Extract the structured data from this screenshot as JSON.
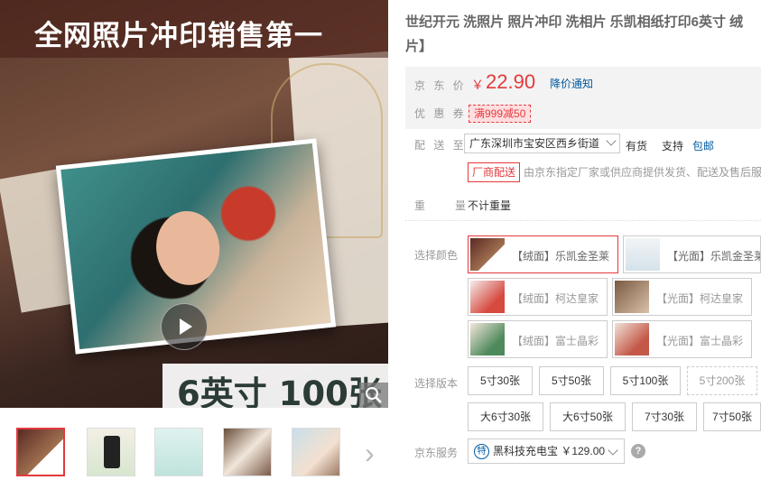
{
  "main_image": {
    "banner_text": "全网照片冲印销售第一",
    "size_text": "6英寸 100张"
  },
  "product": {
    "title_line1": "世纪开元 洗照片 照片冲印 洗相片 乐凯相纸打印6英寸 绒",
    "title_line2": "片】"
  },
  "price": {
    "label": "京 东 价",
    "currency": "￥",
    "value": "22.90",
    "alert": "降价通知"
  },
  "coupon": {
    "label": "优 惠 券",
    "text": "满999减50"
  },
  "delivery": {
    "label": "配 送 至",
    "address": "广东深圳市宝安区西乡街道",
    "stock": "有货",
    "support_label": "支持",
    "support_link": "包邮",
    "factory_tag": "厂商配送",
    "factory_desc": "由京东指定厂家或供应商提供发货、配送及售后服务"
  },
  "weight": {
    "label": "重　　量",
    "value": "不计重量"
  },
  "color": {
    "label": "选择颜色",
    "options": [
      {
        "text": "【绒面】乐凯金圣莱",
        "selected": true
      },
      {
        "text": "【光面】乐凯金圣莱",
        "selected": false
      },
      {
        "text": "【绒面】柯达皇家",
        "selected": false
      },
      {
        "text": "【光面】柯达皇家",
        "selected": false
      },
      {
        "text": "【绒面】富士晶彩",
        "selected": false
      },
      {
        "text": "【光面】富士晶彩",
        "selected": false
      }
    ]
  },
  "version": {
    "label": "选择版本",
    "options": [
      "5寸30张",
      "5寸50张",
      "5寸100张",
      "5寸200张",
      "大6寸30张",
      "大6寸50张",
      "7寸30张",
      "7寸50张"
    ]
  },
  "service": {
    "label": "京东服务",
    "badge": "特",
    "text": "黑科技充电宝 ￥129.00",
    "help": "?"
  },
  "colors": {
    "price_red": "#e4393c",
    "link_blue": "#005aa0"
  }
}
